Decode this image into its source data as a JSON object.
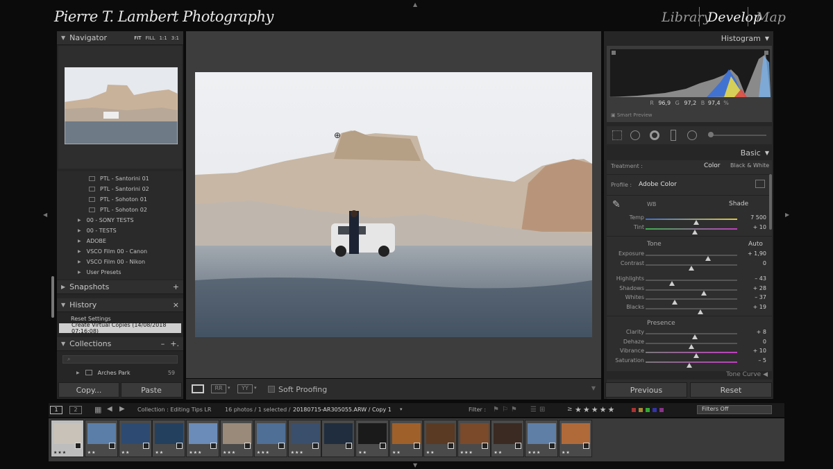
{
  "identity_plate": "Pierre T. Lambert Photography",
  "modules": [
    "Library",
    "Develop",
    "Map"
  ],
  "navigator": {
    "title": "Navigator",
    "zoom_options": [
      "FIT",
      "FILL",
      "1:1",
      "3:1"
    ]
  },
  "presets": [
    {
      "label": "PTL - Santorini 01",
      "type": "preset"
    },
    {
      "label": "PTL - Santorini 02",
      "type": "preset"
    },
    {
      "label": "PTL - Sohoton 01",
      "type": "preset"
    },
    {
      "label": "PTL - Sohoton 02",
      "type": "preset"
    },
    {
      "label": "00 - SONY TESTS",
      "type": "folder"
    },
    {
      "label": "00 - TESTS",
      "type": "folder"
    },
    {
      "label": "ADOBE",
      "type": "folder"
    },
    {
      "label": "VSCO Film 00 - Canon",
      "type": "folder"
    },
    {
      "label": "VSCO Film 00 - Nikon",
      "type": "folder"
    },
    {
      "label": "User Presets",
      "type": "folder"
    }
  ],
  "snapshots": {
    "title": "Snapshots",
    "action": "+"
  },
  "history": {
    "title": "History",
    "action": "×",
    "items": [
      "Reset Settings",
      "Create Virtual Copies (14/08/2018 07:16:08)"
    ]
  },
  "collections": {
    "title": "Collections",
    "actions": [
      "–",
      "+."
    ],
    "item": "Arches Park",
    "count": "59"
  },
  "left_buttons": {
    "copy": "Copy...",
    "paste": "Paste"
  },
  "toolbar": {
    "soft_proofing": "Soft Proofing"
  },
  "histogram": {
    "title": "Histogram",
    "r_label": "R",
    "r": "96,9",
    "g_label": "G",
    "g": "97,2",
    "b_label": "B",
    "b": "97,4",
    "unit": "%",
    "smart_preview": "Smart Preview"
  },
  "basic": {
    "title": "Basic",
    "treatment_label": "Treatment :",
    "treatment_options": [
      "Color",
      "Black & White"
    ],
    "profile_label": "Profile :",
    "profile_value": "Adobe Color",
    "wb_label": "WB",
    "wb_value": "Shade",
    "tone_label": "Tone",
    "tone_auto": "Auto",
    "presence_label": "Presence",
    "sliders": [
      {
        "label": "Temp",
        "value": "7 500",
        "pos": 0.55
      },
      {
        "label": "Tint",
        "value": "+ 10",
        "pos": 0.54
      },
      {
        "label": "Exposure",
        "value": "+ 1,90",
        "pos": 0.68
      },
      {
        "label": "Contrast",
        "value": "0",
        "pos": 0.5
      },
      {
        "label": "Highlights",
        "value": "– 43",
        "pos": 0.29
      },
      {
        "label": "Shadows",
        "value": "+ 28",
        "pos": 0.64
      },
      {
        "label": "Whites",
        "value": "– 37",
        "pos": 0.32
      },
      {
        "label": "Blacks",
        "value": "+ 19",
        "pos": 0.6
      },
      {
        "label": "Clarity",
        "value": "+ 8",
        "pos": 0.54
      },
      {
        "label": "Dehaze",
        "value": "0",
        "pos": 0.5
      },
      {
        "label": "Vibrance",
        "value": "+ 10",
        "pos": 0.55
      },
      {
        "label": "Saturation",
        "value": "– 5",
        "pos": 0.48
      }
    ]
  },
  "tone_curve_label": "Tone Curve",
  "right_buttons": {
    "previous": "Previous",
    "reset": "Reset"
  },
  "filmstrip_bar": {
    "page1": "1",
    "page2": "2",
    "collection": "Collection : Editing Tips LR",
    "count_info": "16 photos / 1 selected /",
    "filename": "20180715-AR305055.ARW / Copy 1",
    "filter_label": "Filter :",
    "rating_op": "≥",
    "filters_off": "Filters Off"
  },
  "thumbnails": [
    {
      "stars": "★★★",
      "color": "#c8c2b8"
    },
    {
      "stars": "★★",
      "color": "#5a7ea8"
    },
    {
      "stars": "★★",
      "color": "#2d4b72"
    },
    {
      "stars": "★★",
      "color": "#24405f"
    },
    {
      "stars": "★★★",
      "color": "#6b8cb8"
    },
    {
      "stars": "★★★",
      "color": "#9a8a7a"
    },
    {
      "stars": "★★★",
      "color": "#4f6f96"
    },
    {
      "stars": "★★★",
      "color": "#3a4f6c"
    },
    {
      "stars": "",
      "color": "#1f2d3e"
    },
    {
      "stars": "★★",
      "color": "#1a1a1a"
    },
    {
      "stars": "★★",
      "color": "#a0602a"
    },
    {
      "stars": "★★",
      "color": "#5a3a22"
    },
    {
      "stars": "★★★",
      "color": "#7a4a2a"
    },
    {
      "stars": "★★",
      "color": "#3a2a22"
    },
    {
      "stars": "★★★",
      "color": "#5f7fa6"
    },
    {
      "stars": "★★",
      "color": "#b06a3a"
    }
  ]
}
